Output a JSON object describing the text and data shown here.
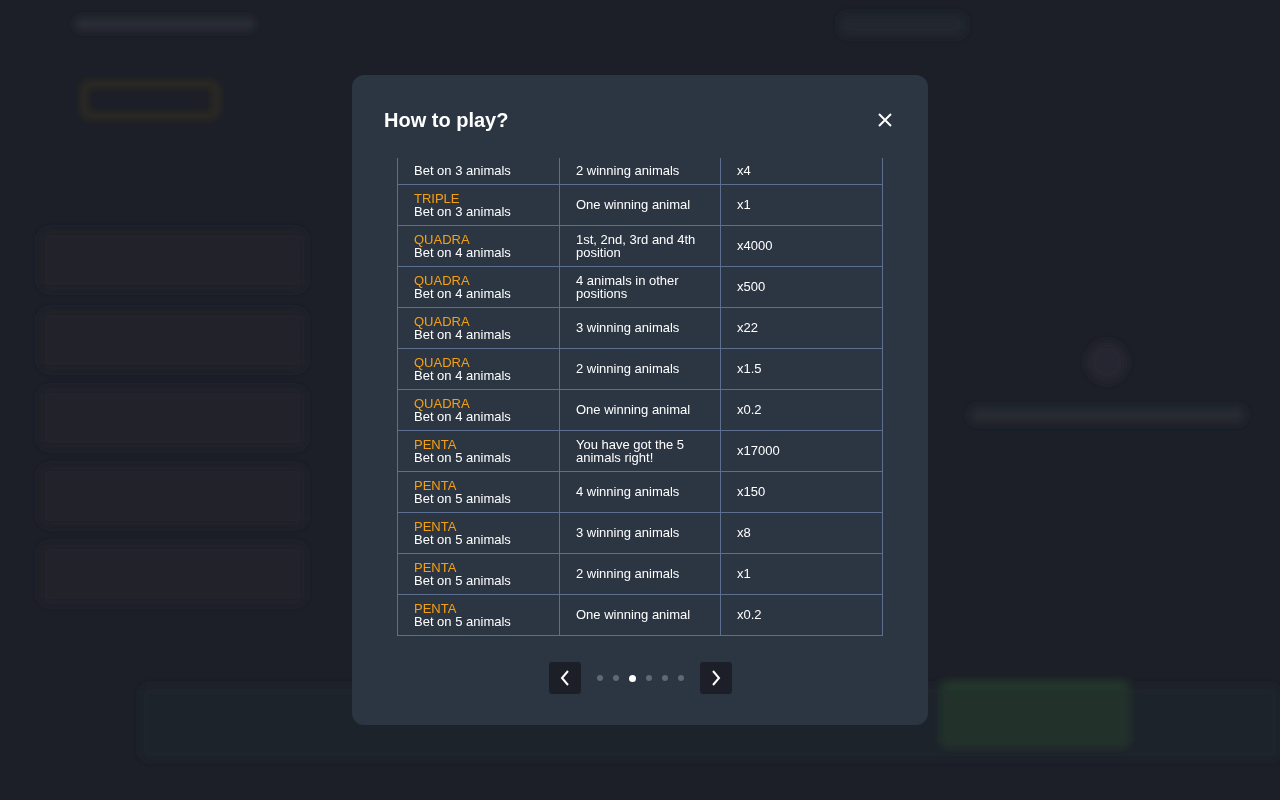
{
  "dialog": {
    "title": "How to play?"
  },
  "table": {
    "rows": [
      {
        "bet": "Bet on 3 animals",
        "result": "2 winning animals",
        "payout": "x4"
      },
      {
        "type": "TRIPLE",
        "bet": "Bet on 3 animals",
        "result": "One winning animal",
        "payout": "x1"
      },
      {
        "type": "QUADRA",
        "bet": "Bet on 4 animals",
        "result": "1st, 2nd, 3rd and 4th position",
        "payout": "x4000"
      },
      {
        "type": "QUADRA",
        "bet": "Bet on 4 animals",
        "result": "4 animals in other positions",
        "payout": "x500"
      },
      {
        "type": "QUADRA",
        "bet": "Bet on 4 animals",
        "result": "3 winning animals",
        "payout": "x22"
      },
      {
        "type": "QUADRA",
        "bet": "Bet on 4 animals",
        "result": "2 winning animals",
        "payout": "x1.5"
      },
      {
        "type": "QUADRA",
        "bet": "Bet on 4 animals",
        "result": "One winning animal",
        "payout": "x0.2"
      },
      {
        "type": "PENTA",
        "bet": "Bet on 5 animals",
        "result": "You have got the 5 animals right!",
        "payout": "x17000"
      },
      {
        "type": "PENTA",
        "bet": "Bet on 5 animals",
        "result": "4 winning animals",
        "payout": "x150"
      },
      {
        "type": "PENTA",
        "bet": "Bet on 5 animals",
        "result": "3 winning animals",
        "payout": "x8"
      },
      {
        "type": "PENTA",
        "bet": "Bet on 5 animals",
        "result": "2 winning animals",
        "payout": "x1"
      },
      {
        "type": "PENTA",
        "bet": "Bet on 5 animals",
        "result": "One winning animal",
        "payout": "x0.2"
      }
    ]
  },
  "pagination": {
    "pages": [
      {
        "selected": false
      },
      {
        "selected": false
      },
      {
        "selected": true
      },
      {
        "selected": false
      },
      {
        "selected": false
      },
      {
        "selected": false
      }
    ]
  }
}
